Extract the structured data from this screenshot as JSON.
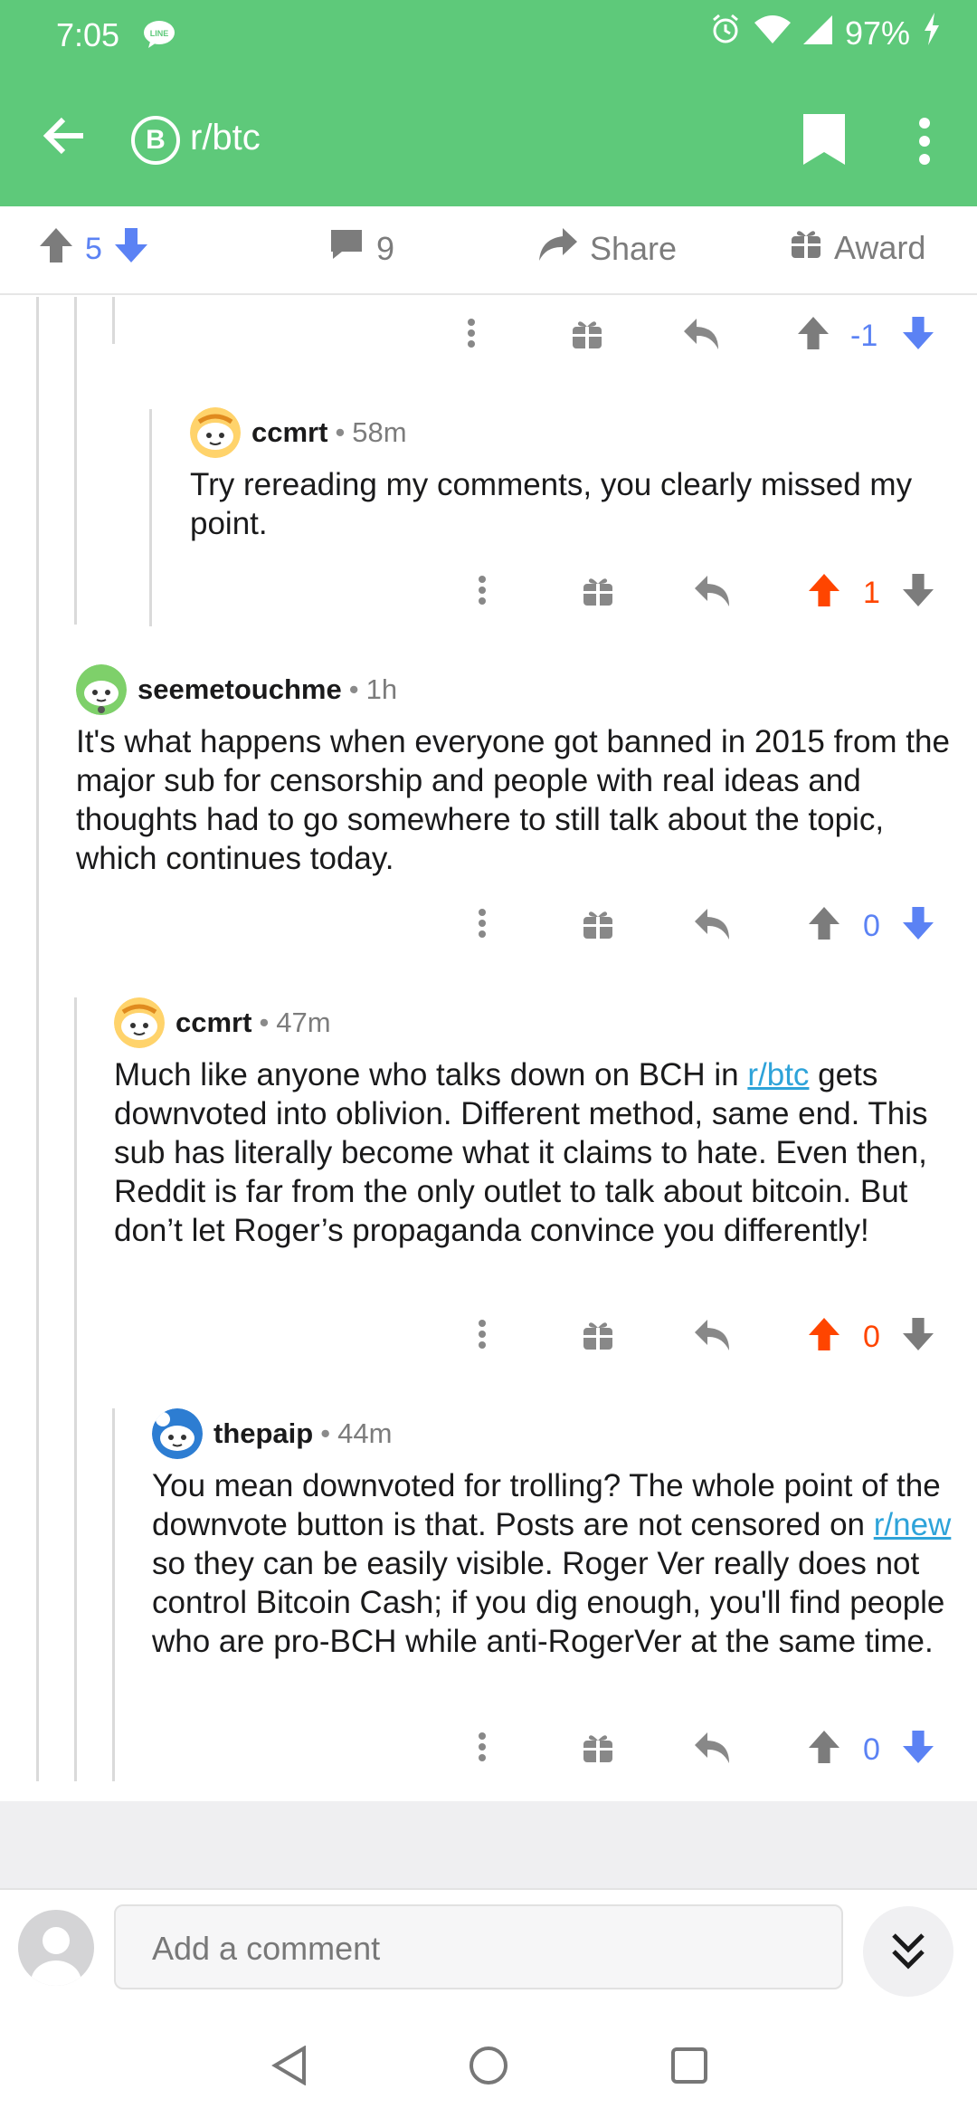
{
  "status": {
    "time": "7:05",
    "battery": "97%"
  },
  "app": {
    "title": "r/btc",
    "sub_icon": "B"
  },
  "post": {
    "score": "5",
    "comments": "9",
    "share": "Share",
    "award": "Award"
  },
  "thread": [
    {
      "votes": "-1",
      "vote_state": "neutral"
    },
    {
      "author": "ccmrt",
      "age": "58m",
      "body": "Try rereading my comments, you clearly missed my point.",
      "votes": "1",
      "vote_state": "up"
    },
    {
      "author": "seemetouchme",
      "age": "1h",
      "body": "It's what happens when everyone got banned in 2015 from the major sub for censorship and people with real ideas and thoughts had to go somewhere to still talk about the topic, which continues today.",
      "votes": "0",
      "vote_state": "neutral"
    },
    {
      "author": "ccmrt",
      "age": "47m",
      "body_before": "Much like anyone who talks down on BCH in ",
      "link": "r/btc",
      "body_after": " gets downvoted into oblivion. Different method, same end. This sub has literally become what it claims to hate. Even then, Reddit is far from the only outlet to talk about bitcoin. But don’t let Roger’s propaganda convince you differently!",
      "votes": "0",
      "vote_state": "up"
    },
    {
      "author": "thepaip",
      "age": "44m",
      "body_before": "You mean downvoted for trolling? The whole point of the downvote button is that. Posts are not censored on ",
      "link": "r/new",
      "body_after": " so they can be easily visible. Roger Ver really does not control Bitcoin Cash; if you dig enough, you'll find people who are pro-BCH while anti-RogerVer at the same time.",
      "votes": "0",
      "vote_state": "neutral"
    }
  ],
  "composer": {
    "placeholder": "Add a comment"
  },
  "colors": {
    "header": "#5ec97a",
    "upvote": "#ff4500",
    "downvote": "#5b82f4",
    "neutral": "#7c7c7c"
  }
}
